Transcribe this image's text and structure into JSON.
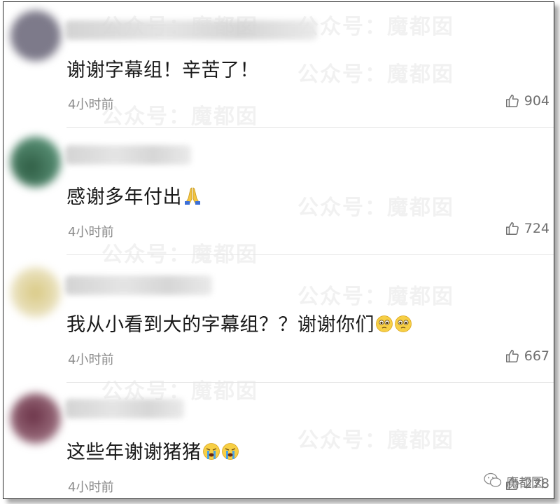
{
  "watermark": "公众号：魔都囡",
  "brand": {
    "label": "魔都囡"
  },
  "comments": [
    {
      "text": "谢谢字幕组！辛苦了！",
      "time": "4小时前",
      "likes": "904",
      "avatar_color": "#7d7a8a",
      "emojis": []
    },
    {
      "text": "感谢多年付出",
      "time": "4小时前",
      "likes": "724",
      "avatar_color": "#4f7a62",
      "emojis": [
        "pray-emoji"
      ]
    },
    {
      "text": "我从小看到大的字幕组？？谢谢你们",
      "time": "4小时前",
      "likes": "667",
      "avatar_color": "#d8cfa6",
      "emojis": [
        "pleading-emoji",
        "pleading-emoji"
      ]
    },
    {
      "text": "这些年谢谢猪猪",
      "time": "4小时前",
      "likes": "278",
      "avatar_color": "#8b5a6a",
      "emojis": [
        "crying-emoji",
        "crying-emoji"
      ]
    }
  ]
}
